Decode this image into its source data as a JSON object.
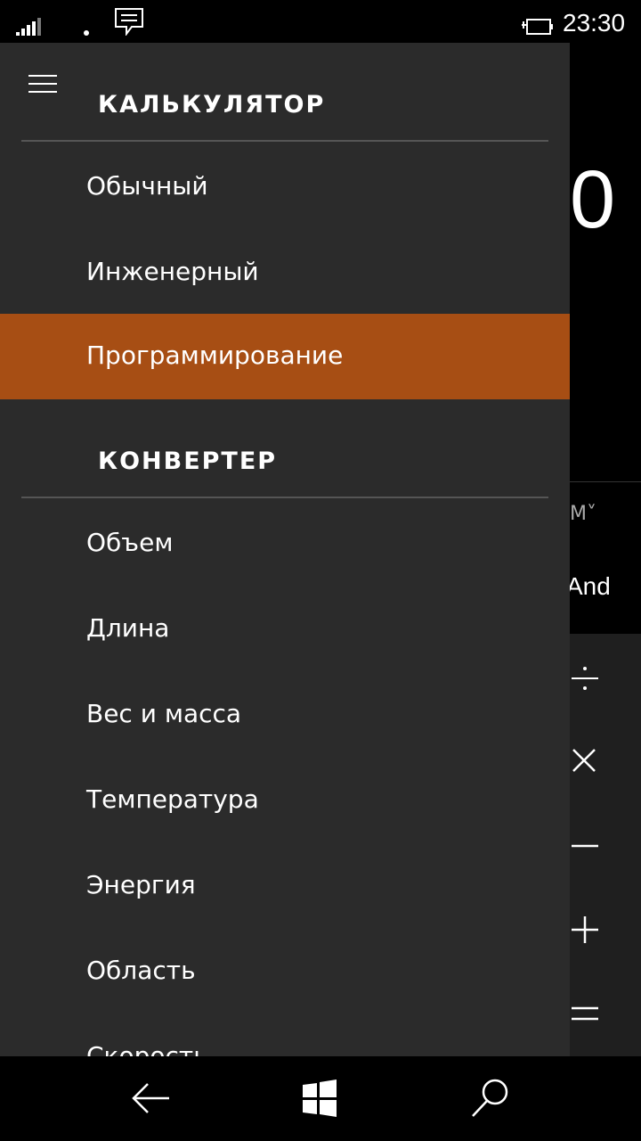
{
  "status": {
    "time": "23:30"
  },
  "drawer": {
    "calculator_title": "КАЛЬКУЛЯТОР",
    "calculator_items": [
      {
        "label": "Обычный",
        "selected": false
      },
      {
        "label": "Инженерный",
        "selected": false
      },
      {
        "label": "Программирование",
        "selected": true
      }
    ],
    "converter_title": "КОНВЕРТЕР",
    "converter_items": [
      {
        "label": "Объем"
      },
      {
        "label": "Длина"
      },
      {
        "label": "Вес и масса"
      },
      {
        "label": "Температура"
      },
      {
        "label": "Энергия"
      },
      {
        "label": "Область"
      },
      {
        "label": "Скорость"
      }
    ]
  },
  "calculator_bg": {
    "display_value": "0",
    "memory_label": "M˅",
    "logic_button": "And"
  },
  "colors": {
    "accent": "#a74e14",
    "drawer_bg": "#2b2b2b"
  },
  "navbar": {
    "icons": [
      "back-arrow-icon",
      "windows-icon",
      "search-icon"
    ]
  }
}
